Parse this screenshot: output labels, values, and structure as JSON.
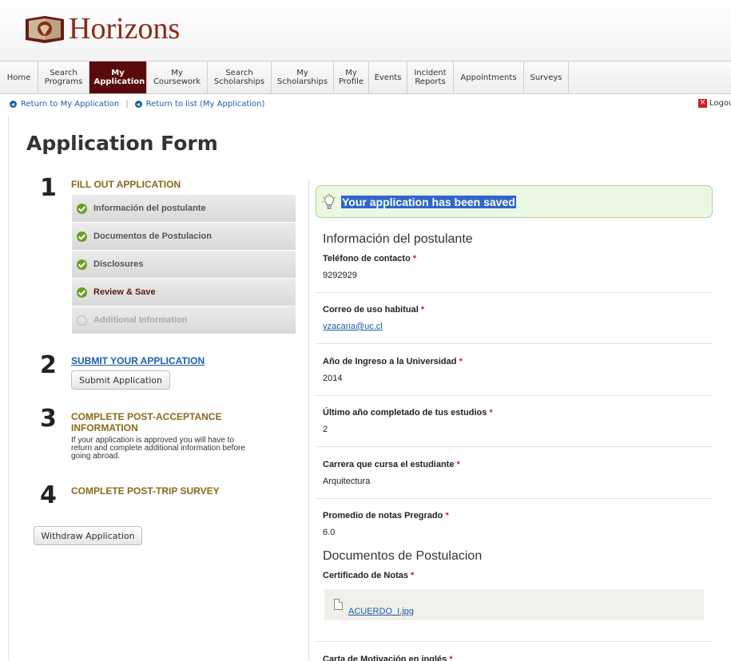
{
  "header": {
    "logo_text": "Horizons"
  },
  "nav": {
    "items": [
      {
        "label": "Home"
      },
      {
        "label": "Search Programs"
      },
      {
        "label": "My Application",
        "active": true
      },
      {
        "label": "My Coursework"
      },
      {
        "label": "Search Scholarships"
      },
      {
        "label": "My Scholarships"
      },
      {
        "label": "My Profile"
      },
      {
        "label": "Events"
      },
      {
        "label": "Incident Reports"
      },
      {
        "label": "Appointments"
      },
      {
        "label": "Surveys"
      }
    ]
  },
  "breadcrumb": {
    "return_application": "Return to My Application",
    "separator": "|",
    "return_list": "Return to list (My Application)"
  },
  "logout_label": "Logout",
  "page_title": "Application Form",
  "steps": {
    "step1": {
      "number": "1",
      "title": "FILL OUT APPLICATION"
    },
    "checklist": [
      {
        "label": "Información del postulante",
        "status": "complete"
      },
      {
        "label": "Documentos de Postulacion",
        "status": "complete"
      },
      {
        "label": "Disclosures",
        "status": "complete"
      },
      {
        "label": "Review & Save",
        "status": "current"
      },
      {
        "label": "Additional Information",
        "status": "pending"
      }
    ],
    "step2": {
      "number": "2",
      "title": "SUBMIT YOUR APPLICATION",
      "button": "Submit Application"
    },
    "step3": {
      "number": "3",
      "title_line1": "COMPLETE POST-ACCEPTANCE",
      "title_line2": "INFORMATION",
      "desc_line1": "If your application is approved you will have to",
      "desc_line2": "return and complete additional information before",
      "desc_line3": "going abroad."
    },
    "step4": {
      "number": "4",
      "title": "COMPLETE POST-TRIP SURVEY"
    },
    "withdraw_button": "Withdraw Application"
  },
  "alert": {
    "message": "Your application has been saved"
  },
  "sections": {
    "postulante": {
      "heading": "Información del postulante",
      "fields": [
        {
          "label": "Teléfono de contacto",
          "value": "9292929"
        },
        {
          "label": "Correo de uso habitual",
          "value": "yzacaria@uc.cl"
        },
        {
          "label": "Año de Ingreso a la Universidad",
          "value": "2014"
        },
        {
          "label": "Último año completado de tus estudios",
          "value": "2"
        },
        {
          "label": "Carrera que cursa el estudiante",
          "value": "Arquitectura"
        },
        {
          "label": "Promedio de notas Pregrado",
          "value": "6.0"
        }
      ]
    },
    "documentos": {
      "heading": "Documentos de Postulacion",
      "certificado_label": "Certificado de Notas",
      "certificado_file": "ACUERDO_I.jpg",
      "carta_label": "Carta de Motivación en inglés"
    }
  },
  "required_mark": "*",
  "colors": {
    "brand": "#5a0a0a",
    "link": "#1a5fa8",
    "step_title": "#8a6a1a",
    "success": "#6a9f24"
  }
}
